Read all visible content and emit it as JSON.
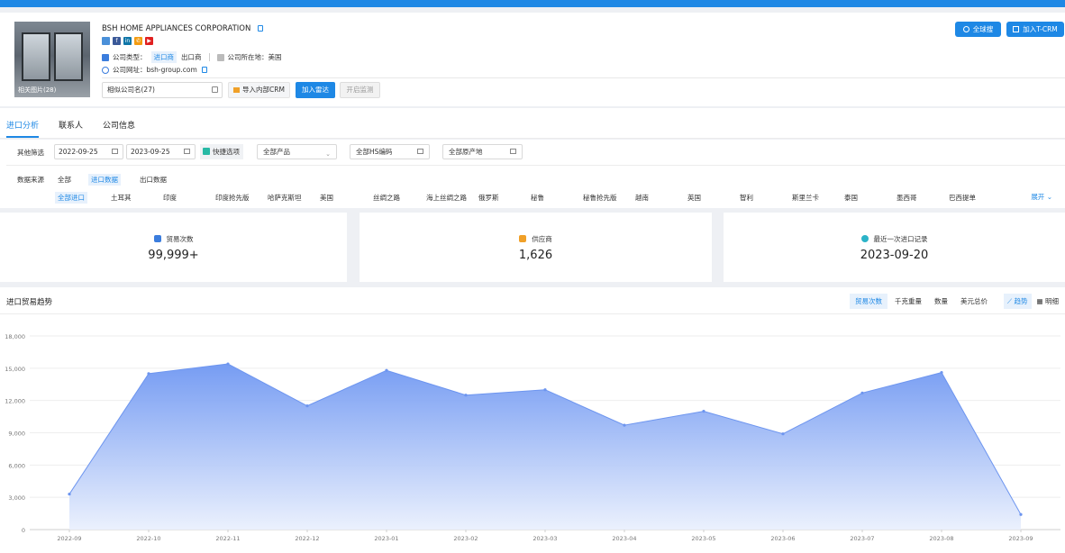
{
  "company": {
    "name": "BSH HOME APPLIANCES CORPORATION",
    "photo_caption": "相关图片(28)",
    "type_label": "公司类型：",
    "type_importer": "进口商",
    "type_exporter": "出口商",
    "location_label": "公司所在地：",
    "location_value": "美国",
    "website_label": "公司网址：",
    "website_value": "bsh-group.com",
    "socials": [
      "linkedin-square",
      "facebook",
      "linkedin",
      "phone",
      "youtube"
    ]
  },
  "actions": {
    "similar_input": "相似公司名(27)",
    "import_crm": "导入内部CRM",
    "add_radar": "加入雷达",
    "start_monitor": "开启监测",
    "global_search": "全球搜",
    "add_tcrm": "加入T-CRM"
  },
  "tabs": [
    "进口分析",
    "联系人",
    "公司信息"
  ],
  "filters": {
    "other_label": "其他筛选",
    "date_start": "2022-09-25",
    "date_end": "2023-09-25",
    "quick_options": "快捷选项",
    "products": "全部产品",
    "hs_codes": "全部HS编码",
    "origins": "全部原产地",
    "source_label": "数据来源",
    "source_options": [
      "全部",
      "进口数据",
      "出口数据"
    ],
    "countries": [
      "全部进口",
      "土耳其",
      "印度",
      "印度抢先版",
      "哈萨克斯坦",
      "美国",
      "丝绸之路",
      "海上丝绸之路",
      "俄罗斯",
      "秘鲁",
      "秘鲁抢先版",
      "越南",
      "英国",
      "智利",
      "斯里兰卡",
      "泰国",
      "墨西哥",
      "巴西提单"
    ],
    "expand": "展开"
  },
  "stats": [
    {
      "label": "贸易次数",
      "value": "99,999+",
      "color": "#3b7ddd"
    },
    {
      "label": "供应商",
      "value": "1,626",
      "color": "#f0a028"
    },
    {
      "label": "最近一次进口记录",
      "value": "2023-09-20",
      "color": "#2bb3c8"
    }
  ],
  "chart_header": {
    "title": "进口贸易趋势",
    "metrics": [
      "贸易次数",
      "千克重量",
      "数量",
      "美元总价"
    ],
    "views": [
      "趋势",
      "明细"
    ]
  },
  "chart_data": {
    "type": "area",
    "title": "进口贸易趋势",
    "categories": [
      "2022-09",
      "2022-10",
      "2022-11",
      "2022-12",
      "2023-01",
      "2023-02",
      "2023-03",
      "2023-04",
      "2023-05",
      "2023-06",
      "2023-07",
      "2023-08",
      "2023-09"
    ],
    "series": [
      {
        "values": [
          3300,
          14500,
          15400,
          11500,
          14800,
          12500,
          13000,
          9700,
          11000,
          8900,
          12700,
          14600,
          1400
        ]
      }
    ],
    "yticks": [
      "0",
      "3,000",
      "6,000",
      "9,000",
      "12,000",
      "15,000",
      "18,000"
    ],
    "ylim": [
      0,
      18000
    ],
    "grid": true,
    "colors": {
      "line": "#6d95ef",
      "fill_top": "#6f97f2",
      "fill_bottom": "#eaf0fd"
    }
  }
}
